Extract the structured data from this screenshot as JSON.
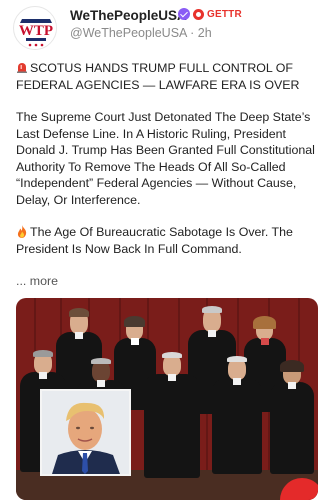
{
  "post": {
    "author_name": "WeThePeopleUSA",
    "platform_label": "GETTR",
    "handle_time": "@WeThePeopleUSA · 2h",
    "avatar_text": "WTP",
    "headline": "SCOTUS HANDS TRUMP FULL CONTROL OF FEDERAL AGENCIES — LAWFARE ERA IS OVER",
    "paragraph_1": "The Supreme Court Just Detonated The Deep State’s Last Defense Line. In A Historic Ruling, President Donald J. Trump Has Been Granted Full Constitutional Authority To Remove The Heads Of All So-Called “Independent” Federal Agencies — Without Cause, Delay, Or Interference.",
    "paragraph_2": "The Age Of Bureaucratic Sabotage Is Over. The President Is Now Back In Full Command.",
    "more_label": "... more"
  },
  "icons": {
    "siren": "police-light-icon",
    "fire": "fire-icon",
    "verified": "verified-badge-icon",
    "gettr": "gettr-logo-icon"
  },
  "colors": {
    "gettr_red": "#e8322c",
    "verified_purple": "#8a5cf5",
    "curtain_red": "#7a1d1a"
  }
}
